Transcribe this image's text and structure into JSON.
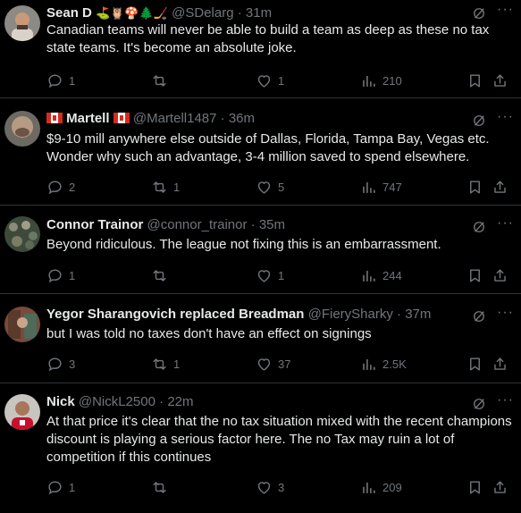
{
  "tweets": [
    {
      "name": "Sean D",
      "name_emoji": "⛳🦉🍄🌲🏒",
      "handle": "@SDelarg",
      "time": "31m",
      "text": "Canadian teams will never be able to build a team as deep as these no tax state teams. It's become an absolute joke.",
      "replies": "1",
      "retweets": "",
      "likes": "1",
      "views": "210"
    },
    {
      "name": "Martell",
      "handle": "@Martell1487",
      "time": "36m",
      "text": "$9-10 mill anywhere else outside of Dallas, Florida, Tampa Bay, Vegas etc. Wonder why such an advantage, 3-4 million saved to spend elsewhere.",
      "replies": "2",
      "retweets": "1",
      "likes": "5",
      "views": "747"
    },
    {
      "name": "Connor Trainor",
      "handle": "@connor_trainor",
      "time": "35m",
      "text": "Beyond ridiculous. The league not fixing this is an embarrassment.",
      "replies": "1",
      "retweets": "",
      "likes": "1",
      "views": "244"
    },
    {
      "name": "Yegor Sharangovich replaced Breadman",
      "handle": "@FierySharky",
      "time": "37m",
      "text": "but I was told no taxes don't have an effect on signings",
      "replies": "3",
      "retweets": "1",
      "likes": "37",
      "views": "2.5K"
    },
    {
      "name": "Nick",
      "handle": "@NickL2500",
      "time": "22m",
      "text": "At that price it's clear that the no tax situation mixed with the recent champions discount is playing a serious factor here. The no Tax may ruin a lot of competition if this continues",
      "replies": "1",
      "retweets": "",
      "likes": "3",
      "views": "209"
    }
  ],
  "separator": "·",
  "icons": [
    "reply-icon",
    "retweet-icon",
    "like-icon",
    "views-icon",
    "bookmark-icon",
    "share-icon",
    "grok-icon",
    "more-icon"
  ],
  "colors": {
    "background": "#000000",
    "text": "#e7e9ea",
    "muted": "#71767b",
    "border": "#2f3336"
  }
}
